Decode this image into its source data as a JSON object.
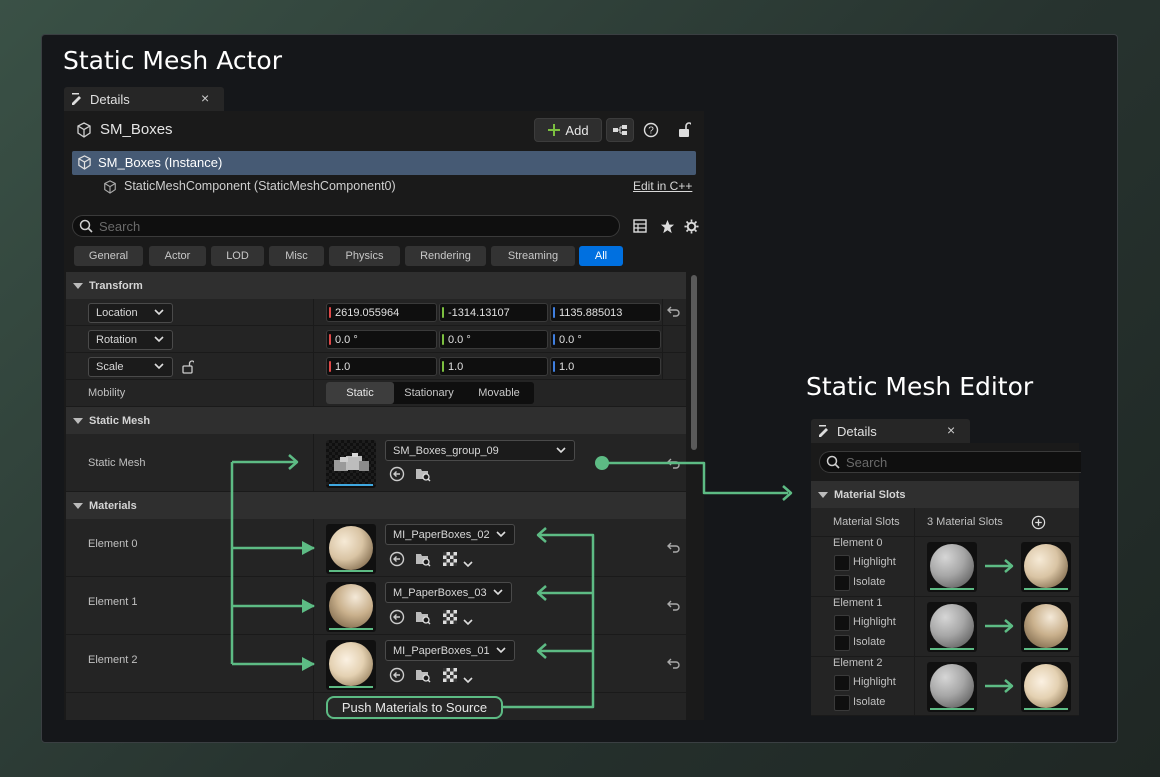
{
  "actor": {
    "section_title": "Static Mesh Actor",
    "tab_label": "Details",
    "object_name": "SM_Boxes",
    "add_label": "Add",
    "instance_label": "SM_Boxes (Instance)",
    "component_label": "StaticMeshComponent (StaticMeshComponent0)",
    "edit_cpp_label": "Edit in C++",
    "search_placeholder": "Search",
    "filters": [
      "General",
      "Actor",
      "LOD",
      "Misc",
      "Physics",
      "Rendering",
      "Streaming",
      "All"
    ],
    "active_filter": "All",
    "transform": {
      "header": "Transform",
      "location_label": "Location",
      "location": [
        "2619.055964",
        "-1314.13107",
        "1135.885013"
      ],
      "rotation_label": "Rotation",
      "rotation": [
        "0.0 °",
        "0.0 °",
        "0.0 °"
      ],
      "scale_label": "Scale",
      "scale": [
        "1.0",
        "1.0",
        "1.0"
      ],
      "mobility_label": "Mobility",
      "mobility_options": [
        "Static",
        "Stationary",
        "Movable"
      ],
      "mobility_selected": "Static"
    },
    "static_mesh": {
      "header": "Static Mesh",
      "row_label": "Static Mesh",
      "asset": "SM_Boxes_group_09"
    },
    "materials": {
      "header": "Materials",
      "elements": [
        {
          "label": "Element 0",
          "asset": "MI_PaperBoxes_02"
        },
        {
          "label": "Element 1",
          "asset": "M_PaperBoxes_03"
        },
        {
          "label": "Element 2",
          "asset": "MI_PaperBoxes_01"
        }
      ],
      "push_label": "Push Materials to Source"
    }
  },
  "editor": {
    "section_title": "Static Mesh Editor",
    "tab_label": "Details",
    "search_placeholder": "Search",
    "category": "Material Slots",
    "slots_label": "Material Slots",
    "slots_count": "3 Material Slots",
    "elements": [
      {
        "label": "Element 0",
        "highlight": "Highlight",
        "isolate": "Isolate"
      },
      {
        "label": "Element 1",
        "highlight": "Highlight",
        "isolate": "Isolate"
      },
      {
        "label": "Element 2",
        "highlight": "Highlight",
        "isolate": "Isolate"
      }
    ]
  },
  "colors": {
    "accent_green": "#5dbb84",
    "axis_x": "#e04848",
    "axis_y": "#7cc040",
    "axis_z": "#3f7fe0",
    "active_blue": "#0070e0"
  }
}
